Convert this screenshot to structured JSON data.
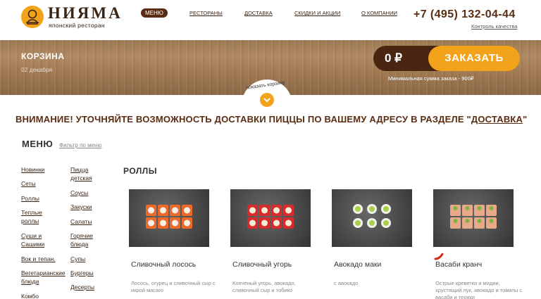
{
  "header": {
    "logo_title": "НИЯМА",
    "logo_subtitle": "японский ресторан",
    "nav": {
      "menu": "МЕНЮ",
      "restaurants": "РЕСТОРАНЫ",
      "delivery": "ДОСТАВКА",
      "discounts": "СКИДКИ И АКЦИИ",
      "about": "О КОМПАНИИ"
    },
    "phone": "+7 (495) 132-04-44",
    "quality_link": "Контроль качества"
  },
  "banner": {
    "title": "КОРЗИНА",
    "date": "02 декабря",
    "cart_sum": "0 ₽",
    "order_button": "ЗАКАЗАТЬ",
    "min_order": "Минимальная сумма заказа - 900₽",
    "show_cart": "показать корзину"
  },
  "notice": {
    "text_before": "ВНИМАНИЕ! УТОЧНЯЙТЕ ВОЗМОЖНОСТЬ ДОСТАВКИ ПИЦЦЫ ПО ВАШЕМУ АДРЕСУ В РАЗДЕЛЕ \"",
    "link": "ДОСТАВКА",
    "text_after": "\""
  },
  "menu": {
    "heading": "МЕНЮ",
    "filter": "Фильтр по меню",
    "col1": [
      "Новинки",
      "Сеты",
      "Роллы",
      "Теплые роллы",
      "Суши и Сашими",
      "Вок и тепан.",
      "Вегетарианские блюда",
      "Комбо"
    ],
    "col2": [
      "Пицца детская",
      "Соусы",
      "Закуски",
      "Салаты",
      "Горячие блюда",
      "Супы",
      "Бургеры",
      "Десерты"
    ]
  },
  "section": {
    "title": "РОЛЛЫ",
    "products": [
      {
        "name": "Сливочный лосось",
        "desc": "Лосось, огурец и сливочный сыр с икрой масаго"
      },
      {
        "name": "Сливочный угорь",
        "desc": "Копченый угорь, авокадо, сливочный сыр и тобико"
      },
      {
        "name": "Авокадо маки",
        "desc": "с авокадо"
      },
      {
        "name": "Васаби кранч",
        "desc": "Острые креветки и мидии, хрустящий лук, авокадо и томаты с васаби и теояки"
      }
    ]
  },
  "colors": {
    "accent": "#f2a31b",
    "brown": "#5a2d12",
    "dark_brown": "#4a2612"
  },
  "icons": {
    "logo": "monk-logo-icon",
    "arrow": "chevron-down-icon",
    "spicy": "chili-pepper-icon"
  }
}
